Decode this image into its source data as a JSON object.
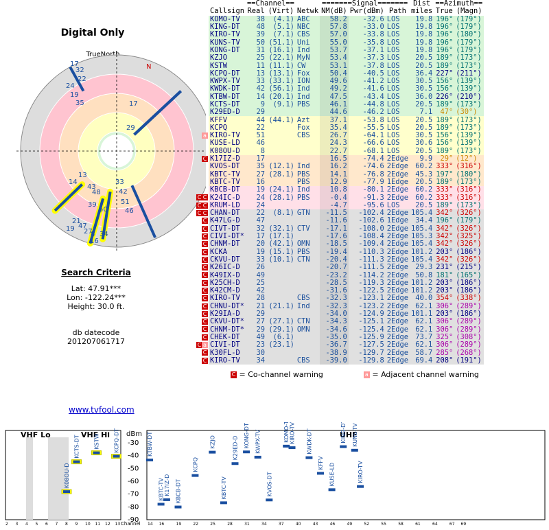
{
  "left": {
    "title": "Digital Only",
    "true_north_label": "TrueNorth",
    "magnetic_label": "N",
    "polar_labels": [
      "17",
      "32",
      "22",
      "24",
      "19",
      "35",
      "17",
      "29",
      "13",
      "14",
      "43",
      "48",
      "39",
      "33",
      "42",
      "50",
      "51",
      "46",
      "21",
      "19",
      "47",
      "27",
      "8",
      "16",
      "34"
    ],
    "criteria_title": "Search Criteria",
    "lat": "Lat: 47.91***",
    "lon": "Lon: -122.24***",
    "height": "Height: 30.0 ft.",
    "db_label": "db datecode",
    "db_value": "201207061717",
    "link": "www.tvfool.com"
  },
  "table": {
    "group_headers": {
      "channel": "==Channel==",
      "signal": "=======Signal=======",
      "dist": "Dist",
      "azimuth": "==Azimuth=="
    },
    "col_headers": [
      "Callsign",
      "Real",
      "(Virt)",
      "Netwk",
      "NM(dB)",
      "Pwr(dBm)",
      "Path",
      "miles",
      "True",
      "(Magn)"
    ],
    "rows": [
      {
        "call": "KOMO-TV",
        "real": "38",
        "virt": "(4.1)",
        "net": "ABC",
        "nm": "58.2",
        "pwr": "-32.6",
        "path": "LOS",
        "dist": "19.8",
        "tru": "196°",
        "mag": "(179°)",
        "bg": "#d8f5d8",
        "warn": ""
      },
      {
        "call": "KING-DT",
        "real": "48",
        "virt": "(5.1)",
        "net": "NBC",
        "nm": "57.8",
        "pwr": "-33.0",
        "path": "LOS",
        "dist": "19.8",
        "tru": "196°",
        "mag": "(179°)",
        "bg": "#d8f5d8",
        "warn": ""
      },
      {
        "call": "KIRO-TV",
        "real": "39",
        "virt": "(7.1)",
        "net": "CBS",
        "nm": "57.0",
        "pwr": "-33.8",
        "path": "LOS",
        "dist": "19.8",
        "tru": "196°",
        "mag": "(180°)",
        "bg": "#d8f5d8",
        "warn": ""
      },
      {
        "call": "KUNS-TV",
        "real": "50",
        "virt": "(51.1)",
        "net": "Uni",
        "nm": "55.0",
        "pwr": "-35.8",
        "path": "LOS",
        "dist": "19.8",
        "tru": "196°",
        "mag": "(179°)",
        "bg": "#d8f5d8",
        "warn": ""
      },
      {
        "call": "KONG-DT",
        "real": "31",
        "virt": "(16.1)",
        "net": "Ind",
        "nm": "53.7",
        "pwr": "-37.1",
        "path": "LOS",
        "dist": "19.8",
        "tru": "196°",
        "mag": "(179°)",
        "bg": "#d8f5d8",
        "warn": ""
      },
      {
        "call": "KZJO",
        "real": "25",
        "virt": "(22.1)",
        "net": "MyN",
        "nm": "53.4",
        "pwr": "-37.3",
        "path": "LOS",
        "dist": "20.5",
        "tru": "189°",
        "mag": "(173°)",
        "bg": "#d8f5d8",
        "warn": ""
      },
      {
        "call": "KSTW",
        "real": "11",
        "virt": "(11.1)",
        "net": "CW",
        "nm": "53.1",
        "pwr": "-37.8",
        "path": "LOS",
        "dist": "20.5",
        "tru": "189°",
        "mag": "(173°)",
        "bg": "#d8f5d8",
        "warn": ""
      },
      {
        "call": "KCPQ-DT",
        "real": "13",
        "virt": "(13.1)",
        "net": "Fox",
        "nm": "50.4",
        "pwr": "-40.5",
        "path": "LOS",
        "dist": "36.4",
        "tru": "227°",
        "mag": "(211°)",
        "bg": "#d8f5d8",
        "warn": ""
      },
      {
        "call": "KWPX-TV",
        "real": "33",
        "virt": "(33.1)",
        "net": "ION",
        "nm": "49.6",
        "pwr": "-41.2",
        "path": "LOS",
        "dist": "30.5",
        "tru": "156°",
        "mag": "(139°)",
        "bg": "#d8f5d8",
        "warn": ""
      },
      {
        "call": "KWDK-DT",
        "real": "42",
        "virt": "(56.1)",
        "net": "Ind",
        "nm": "49.2",
        "pwr": "-41.6",
        "path": "LOS",
        "dist": "30.5",
        "tru": "156°",
        "mag": "(139°)",
        "bg": "#d8f5d8",
        "warn": ""
      },
      {
        "call": "KTBW-DT",
        "real": "14",
        "virt": "(20.1)",
        "net": "Ind",
        "nm": "47.5",
        "pwr": "-43.4",
        "path": "LOS",
        "dist": "36.0",
        "tru": "226°",
        "mag": "(210°)",
        "bg": "#d8f5d8",
        "warn": ""
      },
      {
        "call": "KCTS-DT",
        "real": "9",
        "virt": "(9.1)",
        "net": "PBS",
        "nm": "46.1",
        "pwr": "-44.8",
        "path": "LOS",
        "dist": "20.5",
        "tru": "189°",
        "mag": "(173°)",
        "bg": "#d8f5d8",
        "warn": ""
      },
      {
        "call": "K29ED-D",
        "real": "29",
        "virt": "",
        "net": "",
        "nm": "44.6",
        "pwr": "-46.2",
        "path": "LOS",
        "dist": "7.1",
        "tru": "47°",
        "mag": "(30°)",
        "bg": "#d8f5d8",
        "warn": ""
      },
      {
        "call": "KFFV",
        "real": "44",
        "virt": "(44.1)",
        "net": "Azt",
        "nm": "37.1",
        "pwr": "-53.8",
        "path": "LOS",
        "dist": "20.5",
        "tru": "189°",
        "mag": "(173°)",
        "bg": "#ffffcc",
        "warn": ""
      },
      {
        "call": "KCPQ",
        "real": "22",
        "virt": "",
        "net": "Fox",
        "nm": "35.4",
        "pwr": "-55.5",
        "path": "LOS",
        "dist": "20.5",
        "tru": "189°",
        "mag": "(173°)",
        "bg": "#ffffcc",
        "warn": ""
      },
      {
        "call": "KIRO-TV",
        "real": "51",
        "virt": "",
        "net": "CBS",
        "nm": "26.7",
        "pwr": "-64.1",
        "path": "LOS",
        "dist": "30.5",
        "tru": "156°",
        "mag": "(139°)",
        "bg": "#ffffcc",
        "warn": "a"
      },
      {
        "call": "KUSE-LD",
        "real": "46",
        "virt": "",
        "net": "",
        "nm": "24.3",
        "pwr": "-66.6",
        "path": "LOS",
        "dist": "30.6",
        "tru": "156°",
        "mag": "(139°)",
        "bg": "#ffffcc",
        "warn": ""
      },
      {
        "call": "K08OU-D",
        "real": "8",
        "virt": "",
        "net": "",
        "nm": "22.7",
        "pwr": "-68.1",
        "path": "LOS",
        "dist": "20.5",
        "tru": "189°",
        "mag": "(173°)",
        "bg": "#ffffcc",
        "warn": ""
      },
      {
        "call": "K17IZ-D",
        "real": "17",
        "virt": "",
        "net": "",
        "nm": "16.5",
        "pwr": "-74.4",
        "path": "2Edge",
        "dist": "9.9",
        "tru": "29°",
        "mag": "(12°)",
        "bg": "#ffe8cc",
        "warn": "c"
      },
      {
        "call": "KVOS-DT",
        "real": "35",
        "virt": "(12.1)",
        "net": "Ind",
        "nm": "16.2",
        "pwr": "-74.6",
        "path": "2Edge",
        "dist": "60.2",
        "tru": "333°",
        "mag": "(316°)",
        "bg": "#ffe8cc",
        "warn": ""
      },
      {
        "call": "KBTC-TV",
        "real": "27",
        "virt": "(28.1)",
        "net": "PBS",
        "nm": "14.1",
        "pwr": "-76.8",
        "path": "2Edge",
        "dist": "45.3",
        "tru": "197°",
        "mag": "(180°)",
        "bg": "#ffe8cc",
        "warn": ""
      },
      {
        "call": "KBTC-TV",
        "real": "16",
        "virt": "",
        "net": "PBS",
        "nm": "12.9",
        "pwr": "-77.9",
        "path": "1Edge",
        "dist": "20.5",
        "tru": "189°",
        "mag": "(173°)",
        "bg": "#ffe8cc",
        "warn": ""
      },
      {
        "call": "KBCB-DT",
        "real": "19",
        "virt": "(24.1)",
        "net": "Ind",
        "nm": "10.8",
        "pwr": "-80.1",
        "path": "2Edge",
        "dist": "60.2",
        "tru": "333°",
        "mag": "(316°)",
        "bg": "#ffe0e8",
        "warn": ""
      },
      {
        "call": "K24IC-D",
        "real": "24",
        "virt": "(28.1)",
        "net": "PBS",
        "nm": "-0.4",
        "pwr": "-91.3",
        "path": "2Edge",
        "dist": "60.2",
        "tru": "333°",
        "mag": "(316°)",
        "bg": "#ffe0e8",
        "warn": "cc"
      },
      {
        "call": "KRUM-LD",
        "real": "24",
        "virt": "",
        "net": "",
        "nm": "-4.7",
        "pwr": "-95.6",
        "path": "LOS",
        "dist": "20.5",
        "tru": "189°",
        "mag": "(173°)",
        "bg": "#ffe0e8",
        "warn": "cc"
      },
      {
        "call": "CHAN-DT",
        "real": "22",
        "virt": "(8.1)",
        "net": "GTN",
        "nm": "-11.5",
        "pwr": "-102.4",
        "path": "2Edge",
        "dist": "105.4",
        "tru": "342°",
        "mag": "(326°)",
        "bg": "#e0e0e0",
        "warn": "cc"
      },
      {
        "call": "K47LG-D",
        "real": "47",
        "virt": "",
        "net": "",
        "nm": "-11.6",
        "pwr": "-102.6",
        "path": "1Edge",
        "dist": "34.4",
        "tru": "196°",
        "mag": "(179°)",
        "bg": "#e0e0e0",
        "warn": "c"
      },
      {
        "call": "CIVT-DT",
        "real": "32",
        "virt": "(32.1)",
        "net": "CTV",
        "nm": "-17.1",
        "pwr": "-108.0",
        "path": "2Edge",
        "dist": "105.4",
        "tru": "342°",
        "mag": "(326°)",
        "bg": "#e0e0e0",
        "warn": "c"
      },
      {
        "call": "CIVI-DT*",
        "real": "17",
        "virt": "(17.1)",
        "net": "",
        "nm": "-17.6",
        "pwr": "-108.4",
        "path": "2Edge",
        "dist": "105.3",
        "tru": "342°",
        "mag": "(325°)",
        "bg": "#e0e0e0",
        "warn": "c"
      },
      {
        "call": "CHNM-DT",
        "real": "20",
        "virt": "(42.1)",
        "net": "OMN",
        "nm": "-18.5",
        "pwr": "-109.4",
        "path": "2Edge",
        "dist": "105.4",
        "tru": "342°",
        "mag": "(326°)",
        "bg": "#e0e0e0",
        "warn": "c"
      },
      {
        "call": "KCKA",
        "real": "19",
        "virt": "(15.1)",
        "net": "PBS",
        "nm": "-19.4",
        "pwr": "-110.3",
        "path": "2Edge",
        "dist": "101.2",
        "tru": "203°",
        "mag": "(186°)",
        "bg": "#e0e0e0",
        "warn": "c"
      },
      {
        "call": "CKVU-DT",
        "real": "33",
        "virt": "(10.1)",
        "net": "CTN",
        "nm": "-20.4",
        "pwr": "-111.3",
        "path": "2Edge",
        "dist": "105.4",
        "tru": "342°",
        "mag": "(326°)",
        "bg": "#e0e0e0",
        "warn": "c"
      },
      {
        "call": "K26IC-D",
        "real": "26",
        "virt": "",
        "net": "",
        "nm": "-20.7",
        "pwr": "-111.5",
        "path": "2Edge",
        "dist": "29.3",
        "tru": "231°",
        "mag": "(215°)",
        "bg": "#e0e0e0",
        "warn": "c"
      },
      {
        "call": "K49IX-D",
        "real": "49",
        "virt": "",
        "net": "",
        "nm": "-23.2",
        "pwr": "-114.2",
        "path": "2Edge",
        "dist": "50.8",
        "tru": "181°",
        "mag": "(165°)",
        "bg": "#e0e0e0",
        "warn": "c"
      },
      {
        "call": "K25CH-D",
        "real": "25",
        "virt": "",
        "net": "",
        "nm": "-28.5",
        "pwr": "-119.3",
        "path": "2Edge",
        "dist": "101.2",
        "tru": "203°",
        "mag": "(186°)",
        "bg": "#e0e0e0",
        "warn": "c"
      },
      {
        "call": "K42CM-D",
        "real": "42",
        "virt": "",
        "net": "",
        "nm": "-31.6",
        "pwr": "-122.5",
        "path": "2Edge",
        "dist": "101.2",
        "tru": "203°",
        "mag": "(186°)",
        "bg": "#e0e0e0",
        "warn": "c"
      },
      {
        "call": "KIRO-TV",
        "real": "28",
        "virt": "",
        "net": "CBS",
        "nm": "-32.3",
        "pwr": "-123.1",
        "path": "2Edge",
        "dist": "40.0",
        "tru": "354°",
        "mag": "(338°)",
        "bg": "#e0e0e0",
        "warn": "c"
      },
      {
        "call": "CHNU-DT*",
        "real": "21",
        "virt": "(21.1)",
        "net": "Ind",
        "nm": "-32.3",
        "pwr": "-123.2",
        "path": "2Edge",
        "dist": "62.1",
        "tru": "306°",
        "mag": "(289°)",
        "bg": "#e0e0e0",
        "warn": "c"
      },
      {
        "call": "K29IA-D",
        "real": "29",
        "virt": "",
        "net": "",
        "nm": "-34.0",
        "pwr": "-124.9",
        "path": "2Edge",
        "dist": "101.1",
        "tru": "203°",
        "mag": "(186°)",
        "bg": "#e0e0e0",
        "warn": "c"
      },
      {
        "call": "CKVU-DT*",
        "real": "27",
        "virt": "(27.1)",
        "net": "CTN",
        "nm": "-34.3",
        "pwr": "-125.1",
        "path": "2Edge",
        "dist": "62.1",
        "tru": "306°",
        "mag": "(289°)",
        "bg": "#e0e0e0",
        "warn": "c"
      },
      {
        "call": "CHNM-DT*",
        "real": "29",
        "virt": "(29.1)",
        "net": "OMN",
        "nm": "-34.6",
        "pwr": "-125.4",
        "path": "2Edge",
        "dist": "62.1",
        "tru": "306°",
        "mag": "(289°)",
        "bg": "#e0e0e0",
        "warn": "c"
      },
      {
        "call": "CHEK-DT",
        "real": "49",
        "virt": "(6.1)",
        "net": "",
        "nm": "-35.0",
        "pwr": "-125.9",
        "path": "2Edge",
        "dist": "73.7",
        "tru": "325°",
        "mag": "(308°)",
        "bg": "#e0e0e0",
        "warn": "c"
      },
      {
        "call": "CIVI-DT",
        "real": "23",
        "virt": "(23.1)",
        "net": "",
        "nm": "-36.7",
        "pwr": "-127.5",
        "path": "2Edge",
        "dist": "62.1",
        "tru": "306°",
        "mag": "(289°)",
        "bg": "#e0e0e0",
        "warn": "ca"
      },
      {
        "call": "K30FL-D",
        "real": "30",
        "virt": "",
        "net": "",
        "nm": "-38.9",
        "pwr": "-129.7",
        "path": "2Edge",
        "dist": "58.7",
        "tru": "285°",
        "mag": "(268°)",
        "bg": "#e0e0e0",
        "warn": "c"
      },
      {
        "call": "KIRO-TV",
        "real": "34",
        "virt": "",
        "net": "CBS",
        "nm": "-39.0",
        "pwr": "-129.8",
        "path": "2Edge",
        "dist": "69.4",
        "tru": "208°",
        "mag": "(191°)",
        "bg": "#e0e0e0",
        "warn": "c"
      }
    ],
    "legend_co": "= Co-channel warning",
    "legend_adj": "= Adjacent channel warning",
    "warn_letter_co": "C",
    "warn_letter_adj": "a"
  },
  "spectrum": {
    "vhf_lo_label": "VHF Lo",
    "vhf_hi_label": "VHF Hi",
    "uhf_label": "UHF",
    "dbm_label": "dBm",
    "y_ticks": [
      "-30",
      "-40",
      "-50",
      "-60",
      "-70",
      "-80",
      "-90"
    ],
    "channel_label": "Channel",
    "x_ticks_vhf": [
      "2",
      "3",
      "4",
      "5",
      "6",
      "7",
      "8",
      "9",
      "10",
      "11",
      "12",
      "13"
    ],
    "x_ticks_uhf": [
      "14",
      "16",
      "19",
      "22",
      "25",
      "28",
      "31",
      "34",
      "37",
      "40",
      "43",
      "46",
      "49",
      "52",
      "55",
      "58",
      "61",
      "64",
      "67",
      "69"
    ],
    "stations": [
      {
        "call": "K08OU-D",
        "ch": 8,
        "pwr": -68.1,
        "hl": true
      },
      {
        "call": "KCTS-DT",
        "ch": 9,
        "pwr": -44.8,
        "hl": true
      },
      {
        "call": "KSTW",
        "ch": 11,
        "pwr": -37.8,
        "hl": true
      },
      {
        "call": "KCPQ-DT",
        "ch": 13,
        "pwr": -40.5,
        "hl": true
      },
      {
        "call": "KTBW-DT",
        "ch": 14,
        "pwr": -43.4,
        "hl": false
      },
      {
        "call": "KBTC-TV",
        "ch": 16,
        "pwr": -77.9,
        "hl": false
      },
      {
        "call": "K17IZ-D",
        "ch": 17,
        "pwr": -74.4,
        "hl": false
      },
      {
        "call": "KBCB-DT",
        "ch": 19,
        "pwr": -80.1,
        "hl": false
      },
      {
        "call": "KCPQ",
        "ch": 22,
        "pwr": -55.5,
        "hl": false
      },
      {
        "call": "KZJO",
        "ch": 25,
        "pwr": -37.3,
        "hl": false
      },
      {
        "call": "KBTC-TV",
        "ch": 27,
        "pwr": -76.8,
        "hl": false
      },
      {
        "call": "K29ED-D",
        "ch": 29,
        "pwr": -46.2,
        "hl": false
      },
      {
        "call": "KONG-DT",
        "ch": 31,
        "pwr": -37.1,
        "hl": false
      },
      {
        "call": "KWPX-TV",
        "ch": 33,
        "pwr": -41.2,
        "hl": false
      },
      {
        "call": "KVOS-DT",
        "ch": 35,
        "pwr": -74.6,
        "hl": false
      },
      {
        "call": "KOMO-TV",
        "ch": 38,
        "pwr": -32.6,
        "hl": false
      },
      {
        "call": "KIRO-TV",
        "ch": 39,
        "pwr": -33.8,
        "hl": false
      },
      {
        "call": "KWDK-DT",
        "ch": 42,
        "pwr": -41.6,
        "hl": false
      },
      {
        "call": "KFFV",
        "ch": 44,
        "pwr": -53.8,
        "hl": false
      },
      {
        "call": "KUSE-LD",
        "ch": 46,
        "pwr": -66.6,
        "hl": false
      },
      {
        "call": "KING-DT",
        "ch": 48,
        "pwr": -33.0,
        "hl": false
      },
      {
        "call": "KUNS-TV",
        "ch": 50,
        "pwr": -35.8,
        "hl": false
      },
      {
        "call": "KIRO-TV",
        "ch": 51,
        "pwr": -64.1,
        "hl": false
      }
    ]
  }
}
